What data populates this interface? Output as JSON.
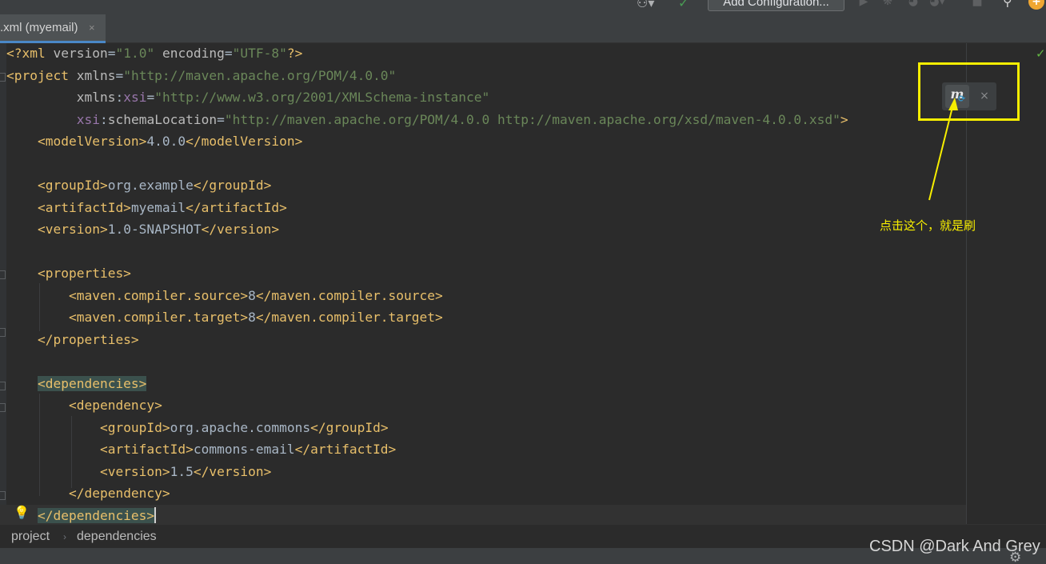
{
  "toolbar": {
    "run_config_label": "Add Configuration...",
    "icons": [
      "user-icon",
      "hammer-icon",
      "run-icon",
      "debug-icon",
      "coverage-icon",
      "profile-icon",
      "stop-icon",
      "search-icon",
      "update-badge-icon"
    ]
  },
  "tab": {
    "label": ".xml (myemail)",
    "close_glyph": "×"
  },
  "editor": {
    "lines": {
      "l1": {
        "open": "<?xml ",
        "attr1": "version",
        "eq1": "=",
        "val1": "\"1.0\"",
        "sp": " ",
        "attr2": "encoding",
        "eq2": "=",
        "val2": "\"UTF-8\"",
        "close": "?>"
      },
      "l2": {
        "open": "<project ",
        "attr": "xmlns",
        "eq": "=",
        "val": "\"http://maven.apache.org/POM/4.0.0\""
      },
      "l3": {
        "indent": "         ",
        "attr": "xmlns",
        "colon": ":",
        "ns": "xsi",
        "eq": "=",
        "val": "\"http://www.w3.org/2001/XMLSchema-instance\""
      },
      "l4": {
        "indent": "         ",
        "ns": "xsi",
        "colon": ":",
        "attr": "schemaLocation",
        "eq": "=",
        "val": "\"http://maven.apache.org/POM/4.0.0 http://maven.apache.org/xsd/maven-4.0.0.xsd\"",
        "close": ">"
      },
      "l5": {
        "indent": "    ",
        "open": "<modelVersion>",
        "text": "4.0.0",
        "close": "</modelVersion>"
      },
      "l7": {
        "indent": "    ",
        "open": "<groupId>",
        "text": "org.example",
        "close": "</groupId>"
      },
      "l8": {
        "indent": "    ",
        "open": "<artifactId>",
        "text": "myemail",
        "close": "</artifactId>"
      },
      "l9": {
        "indent": "    ",
        "open": "<version>",
        "text": "1.0-SNAPSHOT",
        "close": "</version>"
      },
      "l11": {
        "indent": "    ",
        "tag": "<properties>"
      },
      "l12": {
        "indent": "        ",
        "open": "<maven.compiler.source>",
        "text": "8",
        "close": "</maven.compiler.source>"
      },
      "l13": {
        "indent": "        ",
        "open": "<maven.compiler.target>",
        "text": "8",
        "close": "</maven.compiler.target>"
      },
      "l14": {
        "indent": "    ",
        "tag": "</properties>"
      },
      "l16": {
        "indent": "    ",
        "tag": "<dependencies>"
      },
      "l17": {
        "indent": "        ",
        "tag": "<dependency>"
      },
      "l18": {
        "indent": "            ",
        "open": "<groupId>",
        "text": "org.apache.commons",
        "close": "</groupId>"
      },
      "l19": {
        "indent": "            ",
        "open": "<artifactId>",
        "text": "commons-email",
        "close": "</artifactId>"
      },
      "l20": {
        "indent": "            ",
        "open": "<version>",
        "text": "1.5",
        "close": "</version>"
      },
      "l21": {
        "indent": "        ",
        "tag": "</dependency>"
      },
      "l22": {
        "indent": "    ",
        "tag": "</dependencies>"
      }
    },
    "colors": {
      "tag": "#e8bf6a",
      "attribute": "#bababa",
      "namespace": "#9876aa",
      "string": "#6a8759",
      "text": "#a9b7c6",
      "background": "#2b2b2b"
    }
  },
  "maven_popup": {
    "icon_letter": "m",
    "sync_glyph": "⟳",
    "close_glyph": "×"
  },
  "annotation": {
    "note": "点击这个，就是刷",
    "color": "#f7ee00"
  },
  "breadcrumbs": {
    "items": [
      "project",
      "dependencies"
    ],
    "separator": "›"
  },
  "watermark": "CSDN @Dark And Grey"
}
